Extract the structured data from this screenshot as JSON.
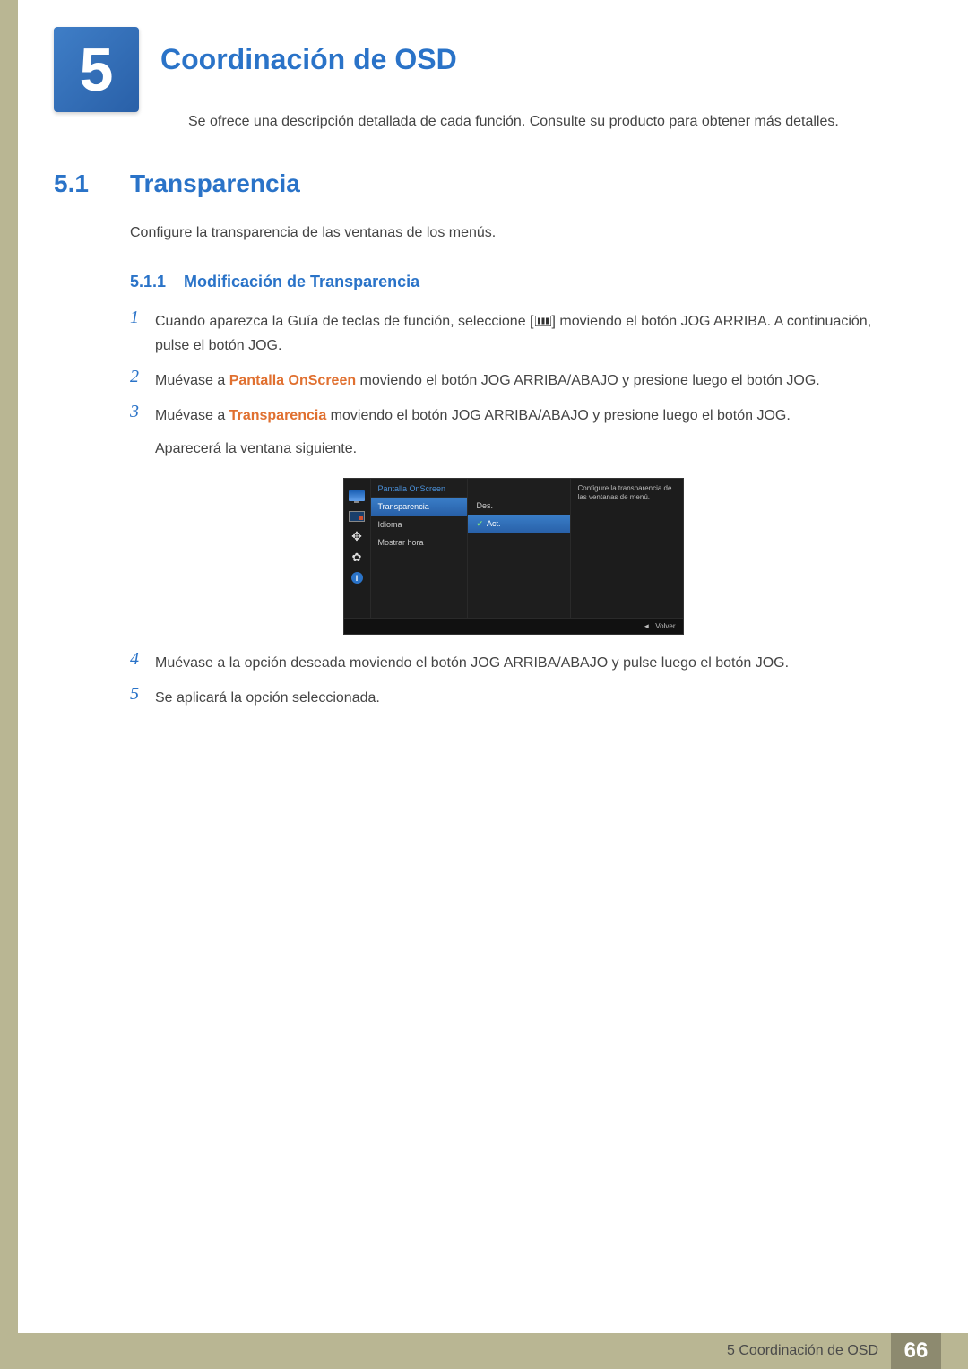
{
  "chapter": {
    "number": "5",
    "title": "Coordinación de OSD",
    "subtitle": "Se ofrece una descripción detallada de cada función. Consulte su producto para obtener más detalles."
  },
  "section": {
    "number": "5.1",
    "title": "Transparencia",
    "description": "Configure la transparencia de las ventanas de los menús."
  },
  "subsection": {
    "number": "5.1.1",
    "title": "Modificación de Transparencia"
  },
  "steps": {
    "s1a": "Cuando aparezca la Guía de teclas de función, seleccione [",
    "s1b": "] moviendo el botón JOG ARRIBA. A continuación, pulse el botón JOG.",
    "s2a": "Muévase a ",
    "s2hl": "Pantalla OnScreen",
    "s2b": " moviendo el botón JOG ARRIBA/ABAJO y presione luego el botón JOG.",
    "s3a": "Muévase a ",
    "s3hl": "Transparencia",
    "s3b": " moviendo el botón JOG ARRIBA/ABAJO y presione luego el botón JOG.",
    "s3c": "Aparecerá la ventana siguiente.",
    "s4": "Muévase a la opción deseada moviendo el botón JOG ARRIBA/ABAJO y pulse luego el botón JOG.",
    "s5": "Se aplicará la opción seleccionada.",
    "n1": "1",
    "n2": "2",
    "n3": "3",
    "n4": "4",
    "n5": "5"
  },
  "osd": {
    "menu_title": "Pantalla OnScreen",
    "items": {
      "transparency": "Transparencia",
      "language": "Idioma",
      "display_time": "Mostrar hora"
    },
    "values": {
      "off": "Des.",
      "on": "Act."
    },
    "description": "Configure la transparencia de las ventanas de menú.",
    "footer": "Volver"
  },
  "footer": {
    "label": "5 Coordinación de OSD",
    "page": "66"
  }
}
